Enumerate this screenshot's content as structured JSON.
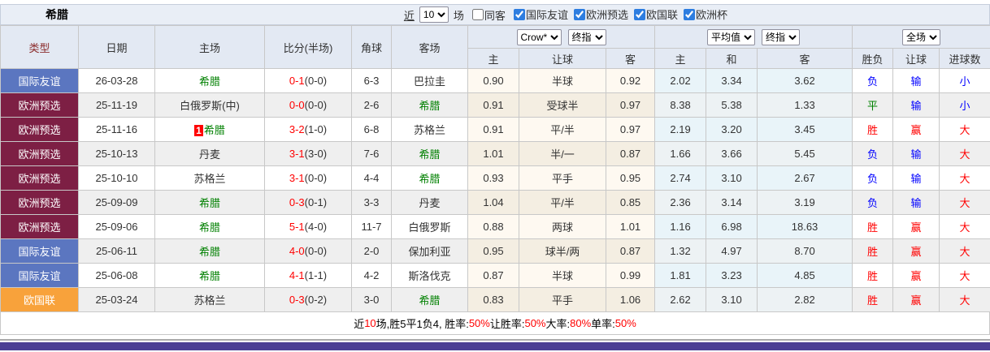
{
  "title": "希腊",
  "topbar": {
    "near_label": "近",
    "match_count": "10",
    "games_label": "场",
    "same_away_label": "同客",
    "same_away_checked": false,
    "filters": [
      {
        "label": "国际友谊",
        "checked": true
      },
      {
        "label": "欧洲预选",
        "checked": true
      },
      {
        "label": "欧国联",
        "checked": true
      },
      {
        "label": "欧洲杯",
        "checked": true
      }
    ]
  },
  "table": {
    "main_headers": [
      "类型",
      "日期",
      "主场",
      "比分(半场)",
      "角球",
      "客场"
    ],
    "odds_group": {
      "company_select": "Crow*",
      "index_select": "终指",
      "cols": [
        "主",
        "让球",
        "客"
      ]
    },
    "avg_group": {
      "avg_select": "平均值",
      "index_select": "终指",
      "cols": [
        "主",
        "和",
        "客"
      ]
    },
    "result_group": {
      "scope_select": "全场",
      "cols": [
        "胜负",
        "让球",
        "进球数"
      ]
    }
  },
  "colors": {
    "league": {
      "国际友谊": "#5B76C0",
      "欧洲预选": "#7D1F44",
      "欧国联": "#F8A23B"
    },
    "win": "#FF0000",
    "draw": "#008000",
    "loss": "#0000FF",
    "footer_bar": "#4B3F94"
  },
  "rows": [
    {
      "league": "国际友谊",
      "date": "26-03-28",
      "home": "希腊",
      "home_badge": "",
      "score": "0-1",
      "half": "(0-0)",
      "corner": "6-3",
      "away": "巴拉圭",
      "crow_home": "0.90",
      "handicap": "半球",
      "crow_away": "0.92",
      "avg_home": "2.02",
      "avg_draw": "3.34",
      "avg_away": "3.62",
      "result": "负",
      "handicap_result": "输",
      "goals_result": "小"
    },
    {
      "league": "欧洲预选",
      "date": "25-11-19",
      "home": "白俄罗斯(中)",
      "home_badge": "",
      "score": "0-0",
      "half": "(0-0)",
      "corner": "2-6",
      "away": "希腊",
      "crow_home": "0.91",
      "handicap": "受球半",
      "crow_away": "0.97",
      "avg_home": "8.38",
      "avg_draw": "5.38",
      "avg_away": "1.33",
      "result": "平",
      "handicap_result": "输",
      "goals_result": "小"
    },
    {
      "league": "欧洲预选",
      "date": "25-11-16",
      "home": "希腊",
      "home_badge": "1",
      "score": "3-2",
      "half": "(1-0)",
      "corner": "6-8",
      "away": "苏格兰",
      "crow_home": "0.91",
      "handicap": "平/半",
      "crow_away": "0.97",
      "avg_home": "2.19",
      "avg_draw": "3.20",
      "avg_away": "3.45",
      "result": "胜",
      "handicap_result": "赢",
      "goals_result": "大"
    },
    {
      "league": "欧洲预选",
      "date": "25-10-13",
      "home": "丹麦",
      "home_badge": "",
      "score": "3-1",
      "half": "(3-0)",
      "corner": "7-6",
      "away": "希腊",
      "crow_home": "1.01",
      "handicap": "半/一",
      "crow_away": "0.87",
      "avg_home": "1.66",
      "avg_draw": "3.66",
      "avg_away": "5.45",
      "result": "负",
      "handicap_result": "输",
      "goals_result": "大"
    },
    {
      "league": "欧洲预选",
      "date": "25-10-10",
      "home": "苏格兰",
      "home_badge": "",
      "score": "3-1",
      "half": "(0-0)",
      "corner": "4-4",
      "away": "希腊",
      "crow_home": "0.93",
      "handicap": "平手",
      "crow_away": "0.95",
      "avg_home": "2.74",
      "avg_draw": "3.10",
      "avg_away": "2.67",
      "result": "负",
      "handicap_result": "输",
      "goals_result": "大"
    },
    {
      "league": "欧洲预选",
      "date": "25-09-09",
      "home": "希腊",
      "home_badge": "",
      "score": "0-3",
      "half": "(0-1)",
      "corner": "3-3",
      "away": "丹麦",
      "crow_home": "1.04",
      "handicap": "平/半",
      "crow_away": "0.85",
      "avg_home": "2.36",
      "avg_draw": "3.14",
      "avg_away": "3.19",
      "result": "负",
      "handicap_result": "输",
      "goals_result": "大"
    },
    {
      "league": "欧洲预选",
      "date": "25-09-06",
      "home": "希腊",
      "home_badge": "",
      "score": "5-1",
      "half": "(4-0)",
      "corner": "11-7",
      "away": "白俄罗斯",
      "crow_home": "0.88",
      "handicap": "两球",
      "crow_away": "1.01",
      "avg_home": "1.16",
      "avg_draw": "6.98",
      "avg_away": "18.63",
      "result": "胜",
      "handicap_result": "赢",
      "goals_result": "大"
    },
    {
      "league": "国际友谊",
      "date": "25-06-11",
      "home": "希腊",
      "home_badge": "",
      "score": "4-0",
      "half": "(0-0)",
      "corner": "2-0",
      "away": "保加利亚",
      "crow_home": "0.95",
      "handicap": "球半/两",
      "crow_away": "0.87",
      "avg_home": "1.32",
      "avg_draw": "4.97",
      "avg_away": "8.70",
      "result": "胜",
      "handicap_result": "赢",
      "goals_result": "大"
    },
    {
      "league": "国际友谊",
      "date": "25-06-08",
      "home": "希腊",
      "home_badge": "",
      "score": "4-1",
      "half": "(1-1)",
      "corner": "4-2",
      "away": "斯洛伐克",
      "crow_home": "0.87",
      "handicap": "半球",
      "crow_away": "0.99",
      "avg_home": "1.81",
      "avg_draw": "3.23",
      "avg_away": "4.85",
      "result": "胜",
      "handicap_result": "赢",
      "goals_result": "大"
    },
    {
      "league": "欧国联",
      "date": "25-03-24",
      "home": "苏格兰",
      "home_badge": "",
      "score": "0-3",
      "half": "(0-2)",
      "corner": "3-0",
      "away": "希腊",
      "crow_home": "0.83",
      "handicap": "平手",
      "crow_away": "1.06",
      "avg_home": "2.62",
      "avg_draw": "3.10",
      "avg_away": "2.82",
      "result": "胜",
      "handicap_result": "赢",
      "goals_result": "大"
    }
  ],
  "summary_segments": [
    {
      "text": "近"
    },
    {
      "text": "10",
      "red": true
    },
    {
      "text": "场,胜5平1负4, 胜率:"
    },
    {
      "text": "50%",
      "red": true
    },
    {
      "text": " 让胜率:"
    },
    {
      "text": "50%",
      "red": true
    },
    {
      "text": " 大率:"
    },
    {
      "text": "80%",
      "red": true
    },
    {
      "text": " 单率:"
    },
    {
      "text": "50%",
      "red": true
    }
  ]
}
